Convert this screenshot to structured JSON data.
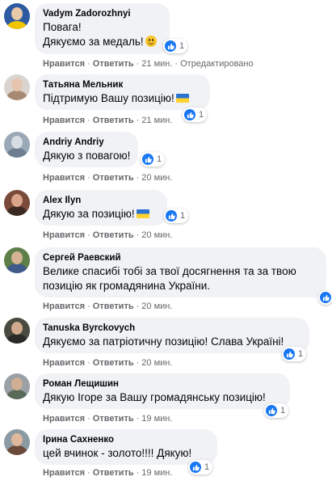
{
  "labels": {
    "like": "Нравится",
    "reply": "Ответить",
    "sep": "·"
  },
  "colors": {
    "bubble": "#f0f2f5",
    "like_blue": "#1877f2",
    "meta_gray": "#65676b"
  },
  "comments": [
    {
      "author": "Vadym Zadorozhnyi",
      "text_lines": [
        "Повага!",
        "Дякуємо за медаль!"
      ],
      "emoji": "smile",
      "reactions": "1",
      "time": "21 мин.",
      "edited": "Отредактировано"
    },
    {
      "author": "Татьяна Мельник",
      "text": "Підтримую Вашу позицію!",
      "emoji": "ukraine-flag",
      "reactions": "1",
      "time": "21 мин."
    },
    {
      "author": "Andriy Andriy",
      "text": "Дякую з повагою!",
      "reactions": "1",
      "time": "20 мин."
    },
    {
      "author": "Alex Ilyn",
      "text": "Дякую за позицію!",
      "emoji": "ukraine-flag",
      "reactions": "1",
      "time": "20 мин."
    },
    {
      "author": "Сергей Раевский",
      "text": "Велике спасибі тобі за твої досягнення та за твою позицію як громадянина України.",
      "time": "20 мин."
    },
    {
      "author": "Tanuska Byrckovych",
      "text": "Дякуємо за патріотичну позицію! Слава Україні!",
      "reactions": "1",
      "time": "20 мин."
    },
    {
      "author": "Роман Лещишин",
      "text": "Дякую Ігоре за Вашу громадянську позицію!",
      "reactions": "1",
      "time": "19 мин."
    },
    {
      "author": "Ірина Сахненко",
      "text": "цей вчинок - золото!!!! Дякую!",
      "reactions": "1",
      "time": "19 мин."
    }
  ]
}
